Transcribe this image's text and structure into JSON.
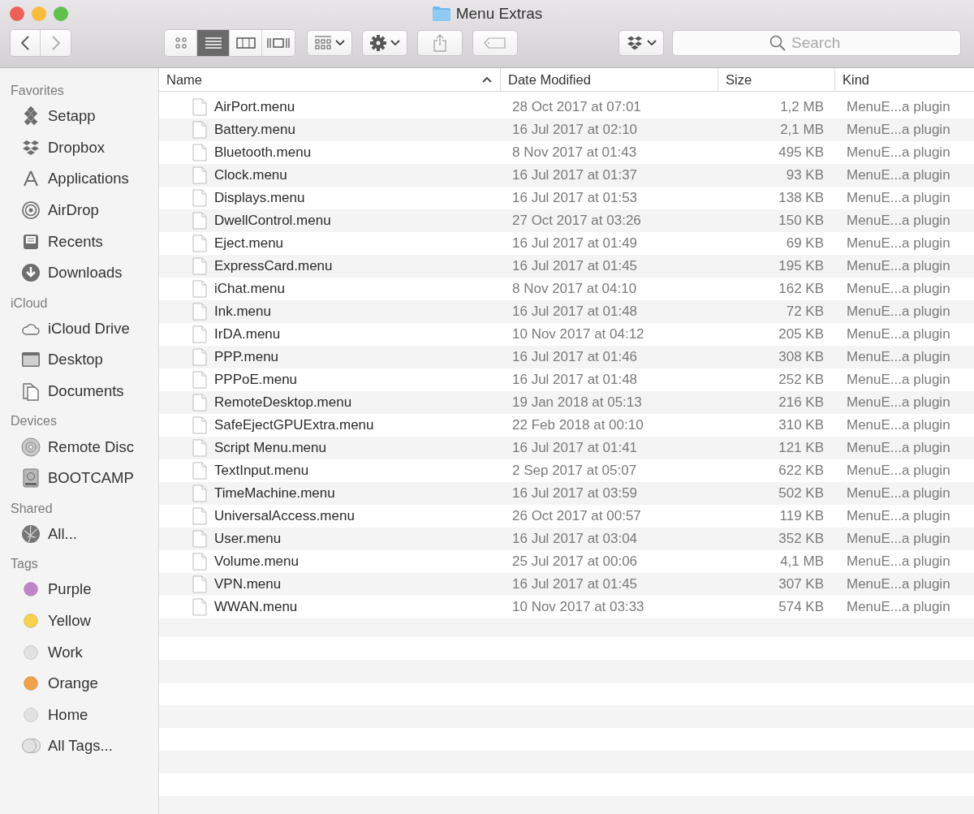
{
  "window": {
    "title": "Menu Extras"
  },
  "toolbar": {
    "views": [
      {
        "kind": "icons",
        "selected": false
      },
      {
        "kind": "list",
        "selected": true
      },
      {
        "kind": "columns",
        "selected": false
      },
      {
        "kind": "gallery",
        "selected": false
      }
    ],
    "search": {
      "placeholder": "Search"
    }
  },
  "sidebar": {
    "sections": [
      {
        "title": "Favorites",
        "items": [
          {
            "label": "Setapp",
            "kind": "setapp"
          },
          {
            "label": "Dropbox",
            "kind": "dropbox"
          },
          {
            "label": "Applications",
            "kind": "apps"
          },
          {
            "label": "AirDrop",
            "kind": "airdrop"
          },
          {
            "label": "Recents",
            "kind": "recents"
          },
          {
            "label": "Downloads",
            "kind": "downloads"
          }
        ]
      },
      {
        "title": "iCloud",
        "items": [
          {
            "label": "iCloud Drive",
            "kind": "cloud"
          },
          {
            "label": "Desktop",
            "kind": "desktop"
          },
          {
            "label": "Documents",
            "kind": "documents"
          }
        ]
      },
      {
        "title": "Devices",
        "items": [
          {
            "label": "Remote Disc",
            "kind": "disc"
          },
          {
            "label": "BOOTCAMP",
            "kind": "drive"
          }
        ]
      },
      {
        "title": "Shared",
        "items": [
          {
            "label": "All...",
            "kind": "network"
          }
        ]
      },
      {
        "title": "Tags",
        "items": [
          {
            "label": "Purple",
            "kind": "tag",
            "color": "#c084c8"
          },
          {
            "label": "Yellow",
            "kind": "tag",
            "color": "#f8d24c"
          },
          {
            "label": "Work",
            "kind": "tag",
            "color": "#e2e2e2"
          },
          {
            "label": "Orange",
            "kind": "tag",
            "color": "#f0a048"
          },
          {
            "label": "Home",
            "kind": "tag",
            "color": "#e2e2e2"
          },
          {
            "label": "All Tags...",
            "kind": "alltags"
          }
        ]
      }
    ]
  },
  "table": {
    "columns": [
      {
        "label": "Name",
        "sorted": true
      },
      {
        "label": "Date Modified",
        "sorted": false
      },
      {
        "label": "Size",
        "sorted": false
      },
      {
        "label": "Kind",
        "sorted": false
      }
    ],
    "rows": [
      [
        "AirPort.menu",
        "28 Oct 2017 at 07:01",
        "1,2 MB",
        "MenuE...a plugin"
      ],
      [
        "Battery.menu",
        "16 Jul 2017 at 02:10",
        "2,1 MB",
        "MenuE...a plugin"
      ],
      [
        "Bluetooth.menu",
        "8 Nov 2017 at 01:43",
        "495 KB",
        "MenuE...a plugin"
      ],
      [
        "Clock.menu",
        "16 Jul 2017 at 01:37",
        "93 KB",
        "MenuE...a plugin"
      ],
      [
        "Displays.menu",
        "16 Jul 2017 at 01:53",
        "138 KB",
        "MenuE...a plugin"
      ],
      [
        "DwellControl.menu",
        "27 Oct 2017 at 03:26",
        "150 KB",
        "MenuE...a plugin"
      ],
      [
        "Eject.menu",
        "16 Jul 2017 at 01:49",
        "69 KB",
        "MenuE...a plugin"
      ],
      [
        "ExpressCard.menu",
        "16 Jul 2017 at 01:45",
        "195 KB",
        "MenuE...a plugin"
      ],
      [
        "iChat.menu",
        "8 Nov 2017 at 04:10",
        "162 KB",
        "MenuE...a plugin"
      ],
      [
        "Ink.menu",
        "16 Jul 2017 at 01:48",
        "72 KB",
        "MenuE...a plugin"
      ],
      [
        "IrDA.menu",
        "10 Nov 2017 at 04:12",
        "205 KB",
        "MenuE...a plugin"
      ],
      [
        "PPP.menu",
        "16 Jul 2017 at 01:46",
        "308 KB",
        "MenuE...a plugin"
      ],
      [
        "PPPoE.menu",
        "16 Jul 2017 at 01:48",
        "252 KB",
        "MenuE...a plugin"
      ],
      [
        "RemoteDesktop.menu",
        "19 Jan 2018 at 05:13",
        "216 KB",
        "MenuE...a plugin"
      ],
      [
        "SafeEjectGPUExtra.menu",
        "22 Feb 2018 at 00:10",
        "310 KB",
        "MenuE...a plugin"
      ],
      [
        "Script Menu.menu",
        "16 Jul 2017 at 01:41",
        "121 KB",
        "MenuE...a plugin"
      ],
      [
        "TextInput.menu",
        "2 Sep 2017 at 05:07",
        "622 KB",
        "MenuE...a plugin"
      ],
      [
        "TimeMachine.menu",
        "16 Jul 2017 at 03:59",
        "502 KB",
        "MenuE...a plugin"
      ],
      [
        "UniversalAccess.menu",
        "26 Oct 2017 at 00:57",
        "119 KB",
        "MenuE...a plugin"
      ],
      [
        "User.menu",
        "16 Jul 2017 at 03:04",
        "352 KB",
        "MenuE...a plugin"
      ],
      [
        "Volume.menu",
        "25 Jul 2017 at 00:06",
        "4,1 MB",
        "MenuE...a plugin"
      ],
      [
        "VPN.menu",
        "16 Jul 2017 at 01:45",
        "307 KB",
        "MenuE...a plugin"
      ],
      [
        "WWAN.menu",
        "10 Nov 2017 at 03:33",
        "574 KB",
        "MenuE...a plugin"
      ]
    ]
  }
}
